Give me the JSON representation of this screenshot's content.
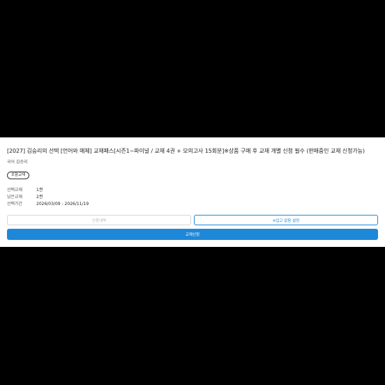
{
  "product": {
    "title": "[2027] 김승리의 선택 [언어와 매체] 교재패스[시즌1~파이널 / 교재 4권 + 모의고사 15회분]※상품 구매 후 교재 개별 신청 필수 (판매중인 교재 신청가능)",
    "subtitle": "국어 김승리",
    "tag": "포함교재"
  },
  "info": [
    {
      "label": "선택교재",
      "value": "1권"
    },
    {
      "label": "남은교재",
      "value": "2권"
    },
    {
      "label": "선택기간",
      "value": "2026/03/09 - 2026/11/19"
    }
  ],
  "buttons": {
    "history_label": "신청내역",
    "guide_label": "※입고 없음 설정",
    "apply_label": "교재신청"
  },
  "colors": {
    "accent": "#1e88d8",
    "background": "#000000",
    "card": "#ffffff"
  }
}
